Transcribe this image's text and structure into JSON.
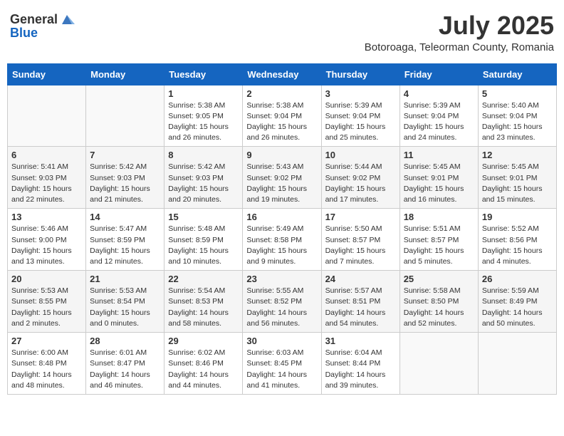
{
  "header": {
    "logo_general": "General",
    "logo_blue": "Blue",
    "month_year": "July 2025",
    "location": "Botoroaga, Teleorman County, Romania"
  },
  "weekdays": [
    "Sunday",
    "Monday",
    "Tuesday",
    "Wednesday",
    "Thursday",
    "Friday",
    "Saturday"
  ],
  "weeks": [
    [
      {
        "day": "",
        "info": ""
      },
      {
        "day": "",
        "info": ""
      },
      {
        "day": "1",
        "info": "Sunrise: 5:38 AM\nSunset: 9:05 PM\nDaylight: 15 hours and 26 minutes."
      },
      {
        "day": "2",
        "info": "Sunrise: 5:38 AM\nSunset: 9:04 PM\nDaylight: 15 hours and 26 minutes."
      },
      {
        "day": "3",
        "info": "Sunrise: 5:39 AM\nSunset: 9:04 PM\nDaylight: 15 hours and 25 minutes."
      },
      {
        "day": "4",
        "info": "Sunrise: 5:39 AM\nSunset: 9:04 PM\nDaylight: 15 hours and 24 minutes."
      },
      {
        "day": "5",
        "info": "Sunrise: 5:40 AM\nSunset: 9:04 PM\nDaylight: 15 hours and 23 minutes."
      }
    ],
    [
      {
        "day": "6",
        "info": "Sunrise: 5:41 AM\nSunset: 9:03 PM\nDaylight: 15 hours and 22 minutes."
      },
      {
        "day": "7",
        "info": "Sunrise: 5:42 AM\nSunset: 9:03 PM\nDaylight: 15 hours and 21 minutes."
      },
      {
        "day": "8",
        "info": "Sunrise: 5:42 AM\nSunset: 9:03 PM\nDaylight: 15 hours and 20 minutes."
      },
      {
        "day": "9",
        "info": "Sunrise: 5:43 AM\nSunset: 9:02 PM\nDaylight: 15 hours and 19 minutes."
      },
      {
        "day": "10",
        "info": "Sunrise: 5:44 AM\nSunset: 9:02 PM\nDaylight: 15 hours and 17 minutes."
      },
      {
        "day": "11",
        "info": "Sunrise: 5:45 AM\nSunset: 9:01 PM\nDaylight: 15 hours and 16 minutes."
      },
      {
        "day": "12",
        "info": "Sunrise: 5:45 AM\nSunset: 9:01 PM\nDaylight: 15 hours and 15 minutes."
      }
    ],
    [
      {
        "day": "13",
        "info": "Sunrise: 5:46 AM\nSunset: 9:00 PM\nDaylight: 15 hours and 13 minutes."
      },
      {
        "day": "14",
        "info": "Sunrise: 5:47 AM\nSunset: 8:59 PM\nDaylight: 15 hours and 12 minutes."
      },
      {
        "day": "15",
        "info": "Sunrise: 5:48 AM\nSunset: 8:59 PM\nDaylight: 15 hours and 10 minutes."
      },
      {
        "day": "16",
        "info": "Sunrise: 5:49 AM\nSunset: 8:58 PM\nDaylight: 15 hours and 9 minutes."
      },
      {
        "day": "17",
        "info": "Sunrise: 5:50 AM\nSunset: 8:57 PM\nDaylight: 15 hours and 7 minutes."
      },
      {
        "day": "18",
        "info": "Sunrise: 5:51 AM\nSunset: 8:57 PM\nDaylight: 15 hours and 5 minutes."
      },
      {
        "day": "19",
        "info": "Sunrise: 5:52 AM\nSunset: 8:56 PM\nDaylight: 15 hours and 4 minutes."
      }
    ],
    [
      {
        "day": "20",
        "info": "Sunrise: 5:53 AM\nSunset: 8:55 PM\nDaylight: 15 hours and 2 minutes."
      },
      {
        "day": "21",
        "info": "Sunrise: 5:53 AM\nSunset: 8:54 PM\nDaylight: 15 hours and 0 minutes."
      },
      {
        "day": "22",
        "info": "Sunrise: 5:54 AM\nSunset: 8:53 PM\nDaylight: 14 hours and 58 minutes."
      },
      {
        "day": "23",
        "info": "Sunrise: 5:55 AM\nSunset: 8:52 PM\nDaylight: 14 hours and 56 minutes."
      },
      {
        "day": "24",
        "info": "Sunrise: 5:57 AM\nSunset: 8:51 PM\nDaylight: 14 hours and 54 minutes."
      },
      {
        "day": "25",
        "info": "Sunrise: 5:58 AM\nSunset: 8:50 PM\nDaylight: 14 hours and 52 minutes."
      },
      {
        "day": "26",
        "info": "Sunrise: 5:59 AM\nSunset: 8:49 PM\nDaylight: 14 hours and 50 minutes."
      }
    ],
    [
      {
        "day": "27",
        "info": "Sunrise: 6:00 AM\nSunset: 8:48 PM\nDaylight: 14 hours and 48 minutes."
      },
      {
        "day": "28",
        "info": "Sunrise: 6:01 AM\nSunset: 8:47 PM\nDaylight: 14 hours and 46 minutes."
      },
      {
        "day": "29",
        "info": "Sunrise: 6:02 AM\nSunset: 8:46 PM\nDaylight: 14 hours and 44 minutes."
      },
      {
        "day": "30",
        "info": "Sunrise: 6:03 AM\nSunset: 8:45 PM\nDaylight: 14 hours and 41 minutes."
      },
      {
        "day": "31",
        "info": "Sunrise: 6:04 AM\nSunset: 8:44 PM\nDaylight: 14 hours and 39 minutes."
      },
      {
        "day": "",
        "info": ""
      },
      {
        "day": "",
        "info": ""
      }
    ]
  ]
}
